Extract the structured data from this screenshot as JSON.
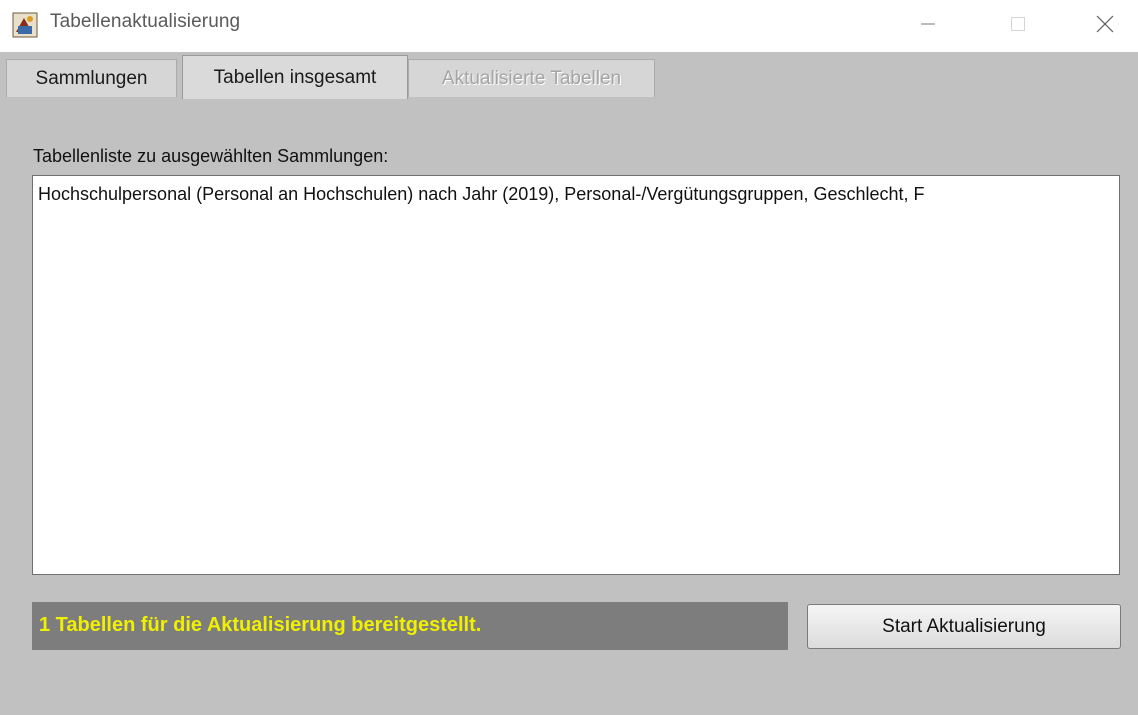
{
  "window": {
    "title": "Tabellenaktualisierung",
    "icon": "app-icon",
    "controls": {
      "minimize": "minimize-icon",
      "maximize": "maximize-icon",
      "close": "close-icon"
    }
  },
  "tabs": [
    {
      "label": "Sammlungen",
      "state": "inactive"
    },
    {
      "label": "Tabellen insgesamt",
      "state": "selected"
    },
    {
      "label": "Aktualisierte Tabellen",
      "state": "disabled"
    }
  ],
  "panel": {
    "list_label": "Tabellenliste zu ausgewählten Sammlungen:",
    "list_items": [
      "Hochschulpersonal (Personal an Hochschulen) nach Jahr (2019), Personal-/Vergütungsgruppen, Geschlecht, F"
    ],
    "status_text": "1 Tabellen für die Aktualisierung bereitgestellt.",
    "start_button": "Start Aktualisierung"
  },
  "colors": {
    "client_bg": "#c1c1c1",
    "status_bg": "#7d7d7d",
    "status_text": "#f0f000",
    "scroll_thumb": "#4f7bbd"
  }
}
